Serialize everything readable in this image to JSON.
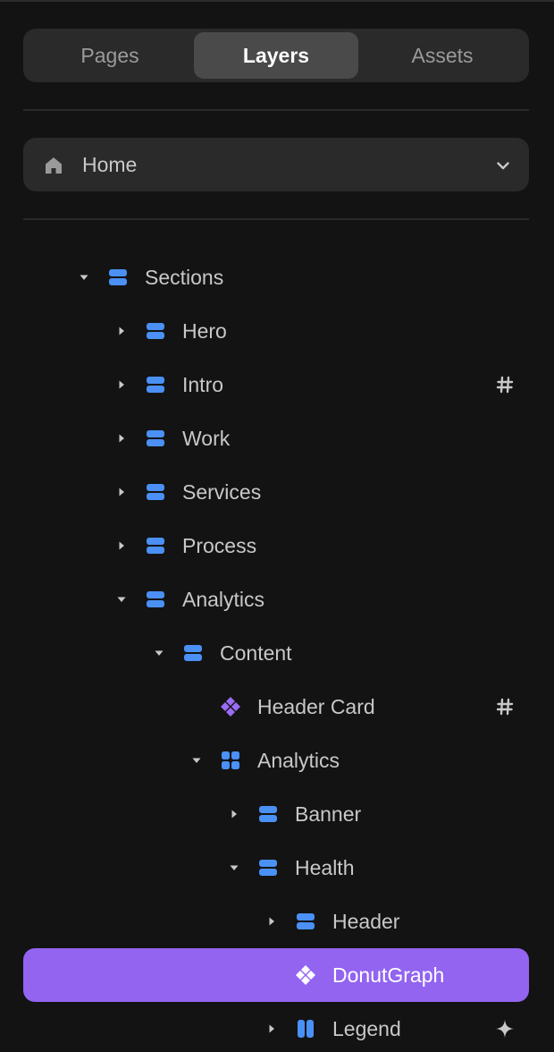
{
  "tabs": {
    "pages": "Pages",
    "layers": "Layers",
    "assets": "Assets",
    "active": "Layers"
  },
  "page_selector": {
    "icon": "home-icon",
    "label": "Home",
    "dropdown_icon": "chevron-down-icon"
  },
  "colors": {
    "frame_icon": "#4a90f5",
    "component_icon": "#9b6cf5",
    "selected_row": "#9264f0"
  },
  "layers": [
    {
      "label": "Sections",
      "level": 0,
      "expanded": true,
      "icon": "stack-frame-icon"
    },
    {
      "label": "Hero",
      "level": 1,
      "expanded": false,
      "icon": "stack-frame-icon"
    },
    {
      "label": "Intro",
      "level": 1,
      "expanded": false,
      "icon": "stack-frame-icon",
      "badge": "hash-icon"
    },
    {
      "label": "Work",
      "level": 1,
      "expanded": false,
      "icon": "stack-frame-icon"
    },
    {
      "label": "Services",
      "level": 1,
      "expanded": false,
      "icon": "stack-frame-icon"
    },
    {
      "label": "Process",
      "level": 1,
      "expanded": false,
      "icon": "stack-frame-icon"
    },
    {
      "label": "Analytics",
      "level": 1,
      "expanded": true,
      "icon": "stack-frame-icon"
    },
    {
      "label": "Content",
      "level": 2,
      "expanded": true,
      "icon": "stack-frame-icon"
    },
    {
      "label": "Header Card",
      "level": 3,
      "icon": "component-icon",
      "badge": "hash-icon"
    },
    {
      "label": "Analytics",
      "level": 3,
      "expanded": true,
      "icon": "grid-frame-icon"
    },
    {
      "label": "Banner",
      "level": 4,
      "expanded": false,
      "icon": "stack-frame-icon"
    },
    {
      "label": "Health",
      "level": 4,
      "expanded": true,
      "icon": "stack-frame-icon"
    },
    {
      "label": "Header",
      "level": 5,
      "expanded": false,
      "icon": "stack-frame-icon"
    },
    {
      "label": "DonutGraph",
      "level": 5,
      "icon": "component-icon",
      "selected": true
    },
    {
      "label": "Legend",
      "level": 5,
      "expanded": false,
      "icon": "horizontal-stack-icon",
      "badge": "sparkle-icon"
    }
  ]
}
